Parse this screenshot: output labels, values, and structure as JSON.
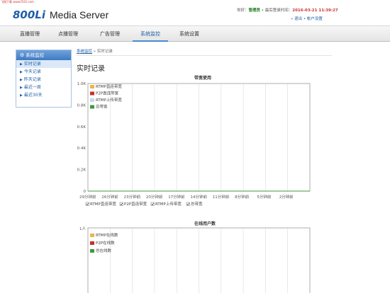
{
  "watermark": "飞翔下载 www.f102.com",
  "brand": {
    "logo": "800Li",
    "title": "Media Server"
  },
  "user": {
    "hello": "你好：",
    "name": "管理员",
    "last_login_label": " • 最后登录时间：",
    "last_login_time": "2016-03-21 11:39:27",
    "logout": "退出",
    "account_settings": "帐户设置"
  },
  "nav": [
    "直播管理",
    "点播管理",
    "广告管理",
    "系统监控",
    "系统设置"
  ],
  "sidebar": {
    "title": "系统监控",
    "items": [
      "实时记录",
      "今天记录",
      "昨天记录",
      "最近一周",
      "最近30天"
    ]
  },
  "breadcrumb": {
    "parent": "系统监控",
    "sep": " » ",
    "current": "实时记录"
  },
  "page_title": "实时记录",
  "chart_data": [
    {
      "type": "line",
      "title": "带宽使用",
      "yticks": [
        "1.0K",
        "0.8K",
        "0.6K",
        "0.4K",
        "0.2K",
        "0"
      ],
      "x": [
        "29分钟前",
        "26分钟前",
        "23分钟前",
        "20分钟前",
        "17分钟前",
        "14分钟前",
        "11分钟前",
        "8分钟前",
        "5分钟前",
        "2分钟前"
      ],
      "ylim": [
        0,
        1000
      ],
      "series": [
        {
          "name": "RTMP直连带宽",
          "color": "#e8b64a",
          "values": [
            0,
            0,
            0,
            0,
            0,
            0,
            0,
            0,
            0,
            0
          ]
        },
        {
          "name": "P2P直连带宽",
          "color": "#c9302c",
          "values": [
            0,
            0,
            0,
            0,
            0,
            0,
            0,
            0,
            0,
            0
          ]
        },
        {
          "name": "RTMP上传带宽",
          "color": "#c6d6ec",
          "values": [
            0,
            0,
            0,
            0,
            0,
            0,
            0,
            0,
            0,
            0
          ]
        },
        {
          "name": "总带宽",
          "color": "#3c9a3c",
          "values": [
            0,
            0,
            0,
            0,
            0,
            0,
            0,
            0,
            0,
            0
          ]
        }
      ],
      "legend": "top-left",
      "checkboxes": [
        "RTMP直连带宽",
        "P2P直连带宽",
        "RTMP上传带宽",
        "总带宽"
      ]
    },
    {
      "type": "line",
      "title": "在线用户数",
      "yticks": [
        "1人"
      ],
      "series": [
        {
          "name": "RTMP在线数",
          "color": "#e8b64a"
        },
        {
          "name": "P2P在线数",
          "color": "#c9302c"
        },
        {
          "name": "总在线数",
          "color": "#3c9a3c"
        }
      ],
      "legend": "top-left"
    }
  ]
}
